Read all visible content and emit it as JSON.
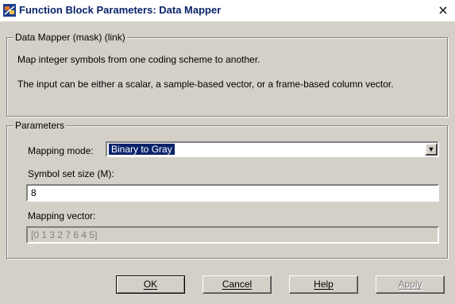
{
  "window": {
    "title": "Function Block Parameters: Data Mapper",
    "close_glyph": "×",
    "app_icon": "simulink-block-icon"
  },
  "mask": {
    "legend": "Data Mapper (mask) (link)",
    "description_1": "Map integer symbols from one coding scheme to another.",
    "description_2": "The input can be either a scalar, a sample-based vector, or a frame-based column vector."
  },
  "parameters": {
    "legend": "Parameters",
    "mapping_mode_label": "Mapping mode:",
    "mapping_mode_value": "Binary to Gray",
    "symbol_set_size_label": "Symbol set size (M):",
    "symbol_set_size_value": "8",
    "mapping_vector_label": "Mapping vector:",
    "mapping_vector_value": "[0 1 3 2 7 6 4 5]"
  },
  "buttons": {
    "ok": "OK",
    "cancel": "Cancel",
    "help": "Help",
    "apply": "Apply"
  },
  "colors": {
    "face": "#d4d0c8",
    "title_text": "#0a246a",
    "selection": "#0a246a"
  }
}
